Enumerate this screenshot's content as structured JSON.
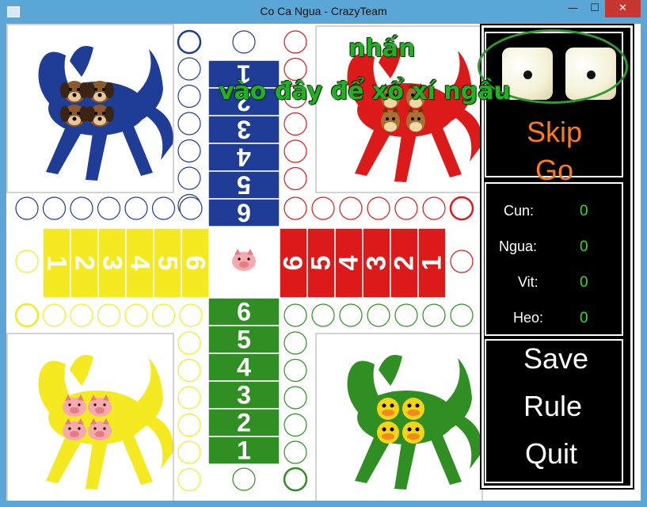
{
  "window": {
    "title": "Co Ca Ngua - CrazyTeam",
    "minimize": "—",
    "maximize": "☐",
    "close": "✕"
  },
  "hint": {
    "line1": "nhấn",
    "line2": "vào đây để xổ xí ngầu"
  },
  "dice": {
    "left_face": 1,
    "right_face": 1
  },
  "actions": {
    "skip": "Skip",
    "go": "Go"
  },
  "scores": [
    {
      "label": "Cun:",
      "value": "0"
    },
    {
      "label": "Ngua:",
      "value": "0"
    },
    {
      "label": "Vit:",
      "value": "0"
    },
    {
      "label": "Heo:",
      "value": "0"
    }
  ],
  "menu": {
    "save": "Save",
    "rule": "Rule",
    "quit": "Quit"
  },
  "board": {
    "home_numbers": {
      "blue": [
        "1",
        "2",
        "3",
        "4",
        "5",
        "6"
      ],
      "yellow": [
        "1",
        "2",
        "3",
        "4",
        "5",
        "6"
      ],
      "red": [
        "6",
        "5",
        "4",
        "3",
        "2",
        "1"
      ],
      "green": [
        "6",
        "5",
        "4",
        "3",
        "2",
        "1"
      ]
    },
    "pieces": {
      "blue": "dog",
      "red": "horse",
      "yellow": "pig",
      "green": "duck",
      "center": "pig"
    }
  },
  "colors": {
    "blue": "#1f3d96",
    "red": "#dd1a1a",
    "yellow": "#f5ea22",
    "green": "#2f8f23",
    "skip_go": "#ff7b1c",
    "score_value": "#2fdc2f",
    "hint": "#22b122"
  }
}
